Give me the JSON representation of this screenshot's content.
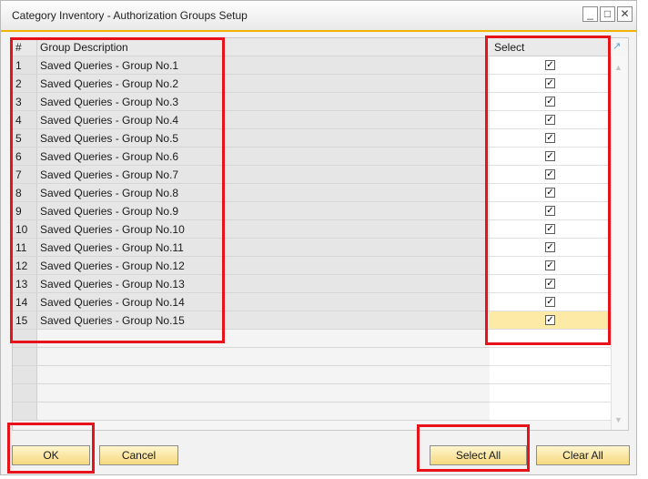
{
  "window": {
    "title": "Category Inventory - Authorization Groups Setup",
    "minimize_glyph": "_",
    "maximize_glyph": "□",
    "close_glyph": "✕"
  },
  "table": {
    "columns": {
      "num": "#",
      "description": "Group Description",
      "select": "Select"
    },
    "rows": [
      {
        "num": "1",
        "description": "Saved Queries - Group No.1",
        "selected": true
      },
      {
        "num": "2",
        "description": "Saved Queries - Group No.2",
        "selected": true
      },
      {
        "num": "3",
        "description": "Saved Queries - Group No.3",
        "selected": true
      },
      {
        "num": "4",
        "description": "Saved Queries - Group No.4",
        "selected": true
      },
      {
        "num": "5",
        "description": "Saved Queries - Group No.5",
        "selected": true
      },
      {
        "num": "6",
        "description": "Saved Queries - Group No.6",
        "selected": true
      },
      {
        "num": "7",
        "description": "Saved Queries - Group No.7",
        "selected": true
      },
      {
        "num": "8",
        "description": "Saved Queries - Group No.8",
        "selected": true
      },
      {
        "num": "9",
        "description": "Saved Queries - Group No.9",
        "selected": true
      },
      {
        "num": "10",
        "description": "Saved Queries - Group No.10",
        "selected": true
      },
      {
        "num": "11",
        "description": "Saved Queries - Group No.11",
        "selected": true
      },
      {
        "num": "12",
        "description": "Saved Queries - Group No.12",
        "selected": true
      },
      {
        "num": "13",
        "description": "Saved Queries - Group No.13",
        "selected": true
      },
      {
        "num": "14",
        "description": "Saved Queries - Group No.14",
        "selected": true
      },
      {
        "num": "15",
        "description": "Saved Queries - Group No.15",
        "selected": true
      }
    ],
    "check_glyph": "✓",
    "active_row": 15
  },
  "buttons": {
    "ok": "OK",
    "cancel": "Cancel",
    "select_all": "Select All",
    "clear_all": "Clear All"
  },
  "colors": {
    "title_accent": "#f0b400",
    "button_fill": "#f6d97d",
    "active_cell": "#fdeaa6",
    "highlight_box": "#e8121b"
  }
}
